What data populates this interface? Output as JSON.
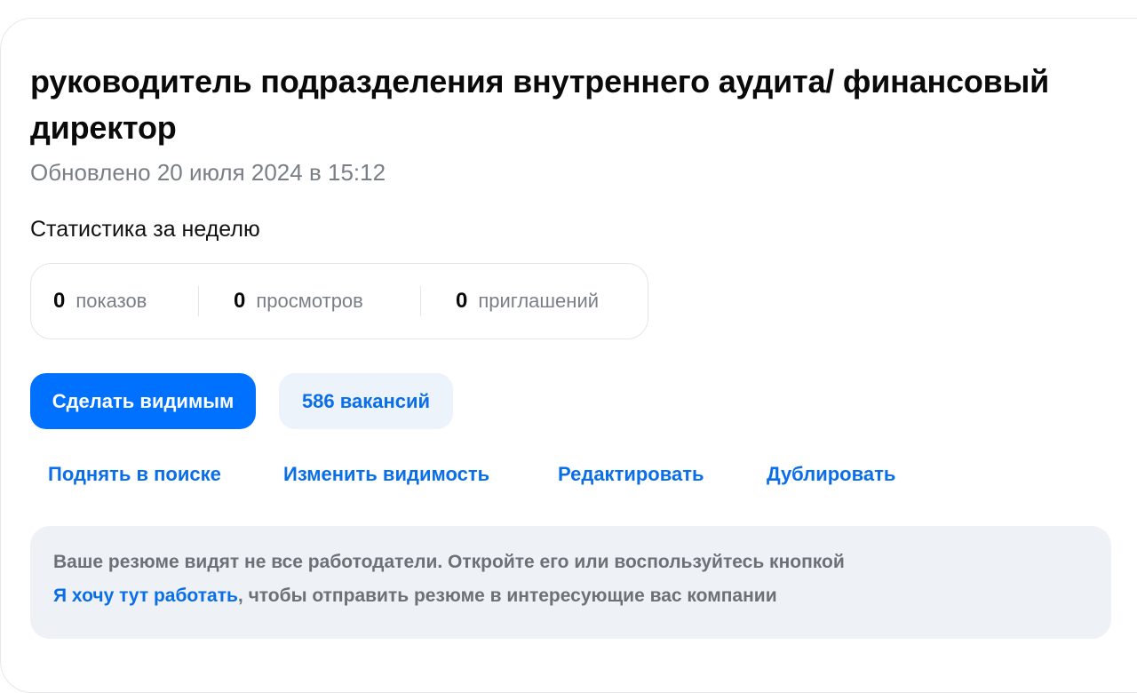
{
  "resume": {
    "title": "руководитель подразделения внутреннего аудита/ финансовый директор",
    "updated": "Обновлено 20 июля 2024 в 15:12"
  },
  "stats": {
    "label": "Статистика за неделю",
    "items": [
      {
        "value": "0",
        "label": "показов"
      },
      {
        "value": "0",
        "label": "просмотров"
      },
      {
        "value": "0",
        "label": "приглашений"
      }
    ]
  },
  "actions": {
    "make_visible": "Сделать видимым",
    "vacancies": "586 вакансий",
    "links": [
      "Поднять в поиске",
      "Изменить видимость",
      "Редактировать",
      "Дублировать"
    ]
  },
  "notice": {
    "text1": "Ваше резюме видят не все работодатели. Откройте его или воспользуйтесь кнопкой",
    "link": "Я хочу тут работать",
    "text2": ", чтобы отправить резюме в интересующие вас компании"
  },
  "colors": {
    "accent": "#0070ff",
    "link": "#0a6ee8",
    "muted_text": "#7a7f87",
    "notice_bg": "#eef2f7"
  }
}
